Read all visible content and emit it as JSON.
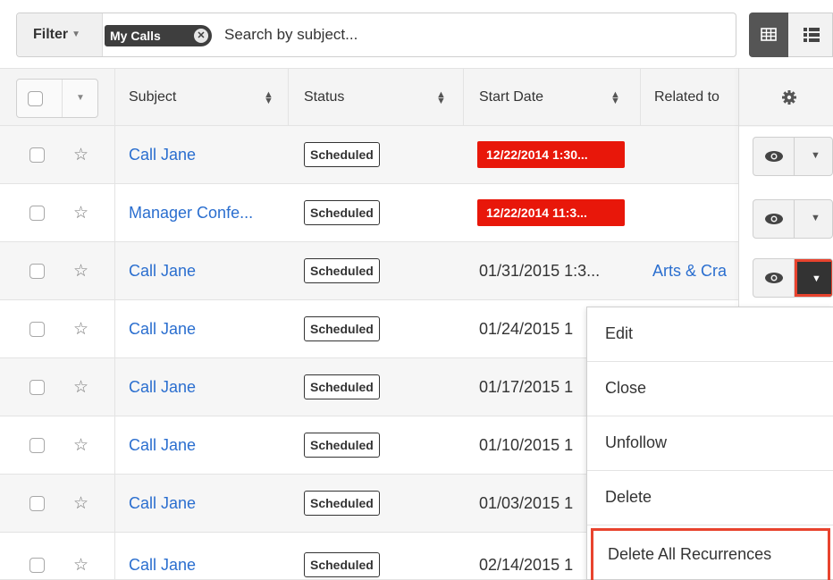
{
  "filter": {
    "label": "Filter",
    "pill": "My Calls",
    "search_placeholder": "Search by subject..."
  },
  "columns": {
    "subject": "Subject",
    "status": "Status",
    "start_date": "Start Date",
    "related_to": "Related to"
  },
  "rows": [
    {
      "subject": "Call Jane",
      "status": "Scheduled",
      "start_date": "12/22/2014 1:30...",
      "related": "",
      "overdue": true
    },
    {
      "subject": "Manager Confe...",
      "status": "Scheduled",
      "start_date": "12/22/2014 11:3...",
      "related": "",
      "overdue": true
    },
    {
      "subject": "Call Jane",
      "status": "Scheduled",
      "start_date": "01/31/2015 1:3...",
      "related": "Arts & Cra",
      "overdue": false
    },
    {
      "subject": "Call Jane",
      "status": "Scheduled",
      "start_date": "01/24/2015 1",
      "related": "",
      "overdue": false
    },
    {
      "subject": "Call Jane",
      "status": "Scheduled",
      "start_date": "01/17/2015 1",
      "related": "",
      "overdue": false
    },
    {
      "subject": "Call Jane",
      "status": "Scheduled",
      "start_date": "01/10/2015 1",
      "related": "",
      "overdue": false
    },
    {
      "subject": "Call Jane",
      "status": "Scheduled",
      "start_date": "01/03/2015 1",
      "related": "",
      "overdue": false
    },
    {
      "subject": "Call Jane",
      "status": "Scheduled",
      "start_date": "02/14/2015 1",
      "related": "",
      "overdue": false
    }
  ],
  "menu": {
    "items": [
      "Edit",
      "Close",
      "Unfollow",
      "Delete",
      "Delete All Recurrences"
    ],
    "highlighted": "Delete All Recurrences"
  },
  "colors": {
    "accent_link": "#2a6ecf",
    "overdue": "#e8170a",
    "highlight_border": "#e8432e"
  },
  "icons": [
    "chevron-down-icon",
    "close-icon",
    "table-view-icon",
    "list-view-icon",
    "sort-icon",
    "gear-icon",
    "star-icon",
    "eye-icon"
  ]
}
